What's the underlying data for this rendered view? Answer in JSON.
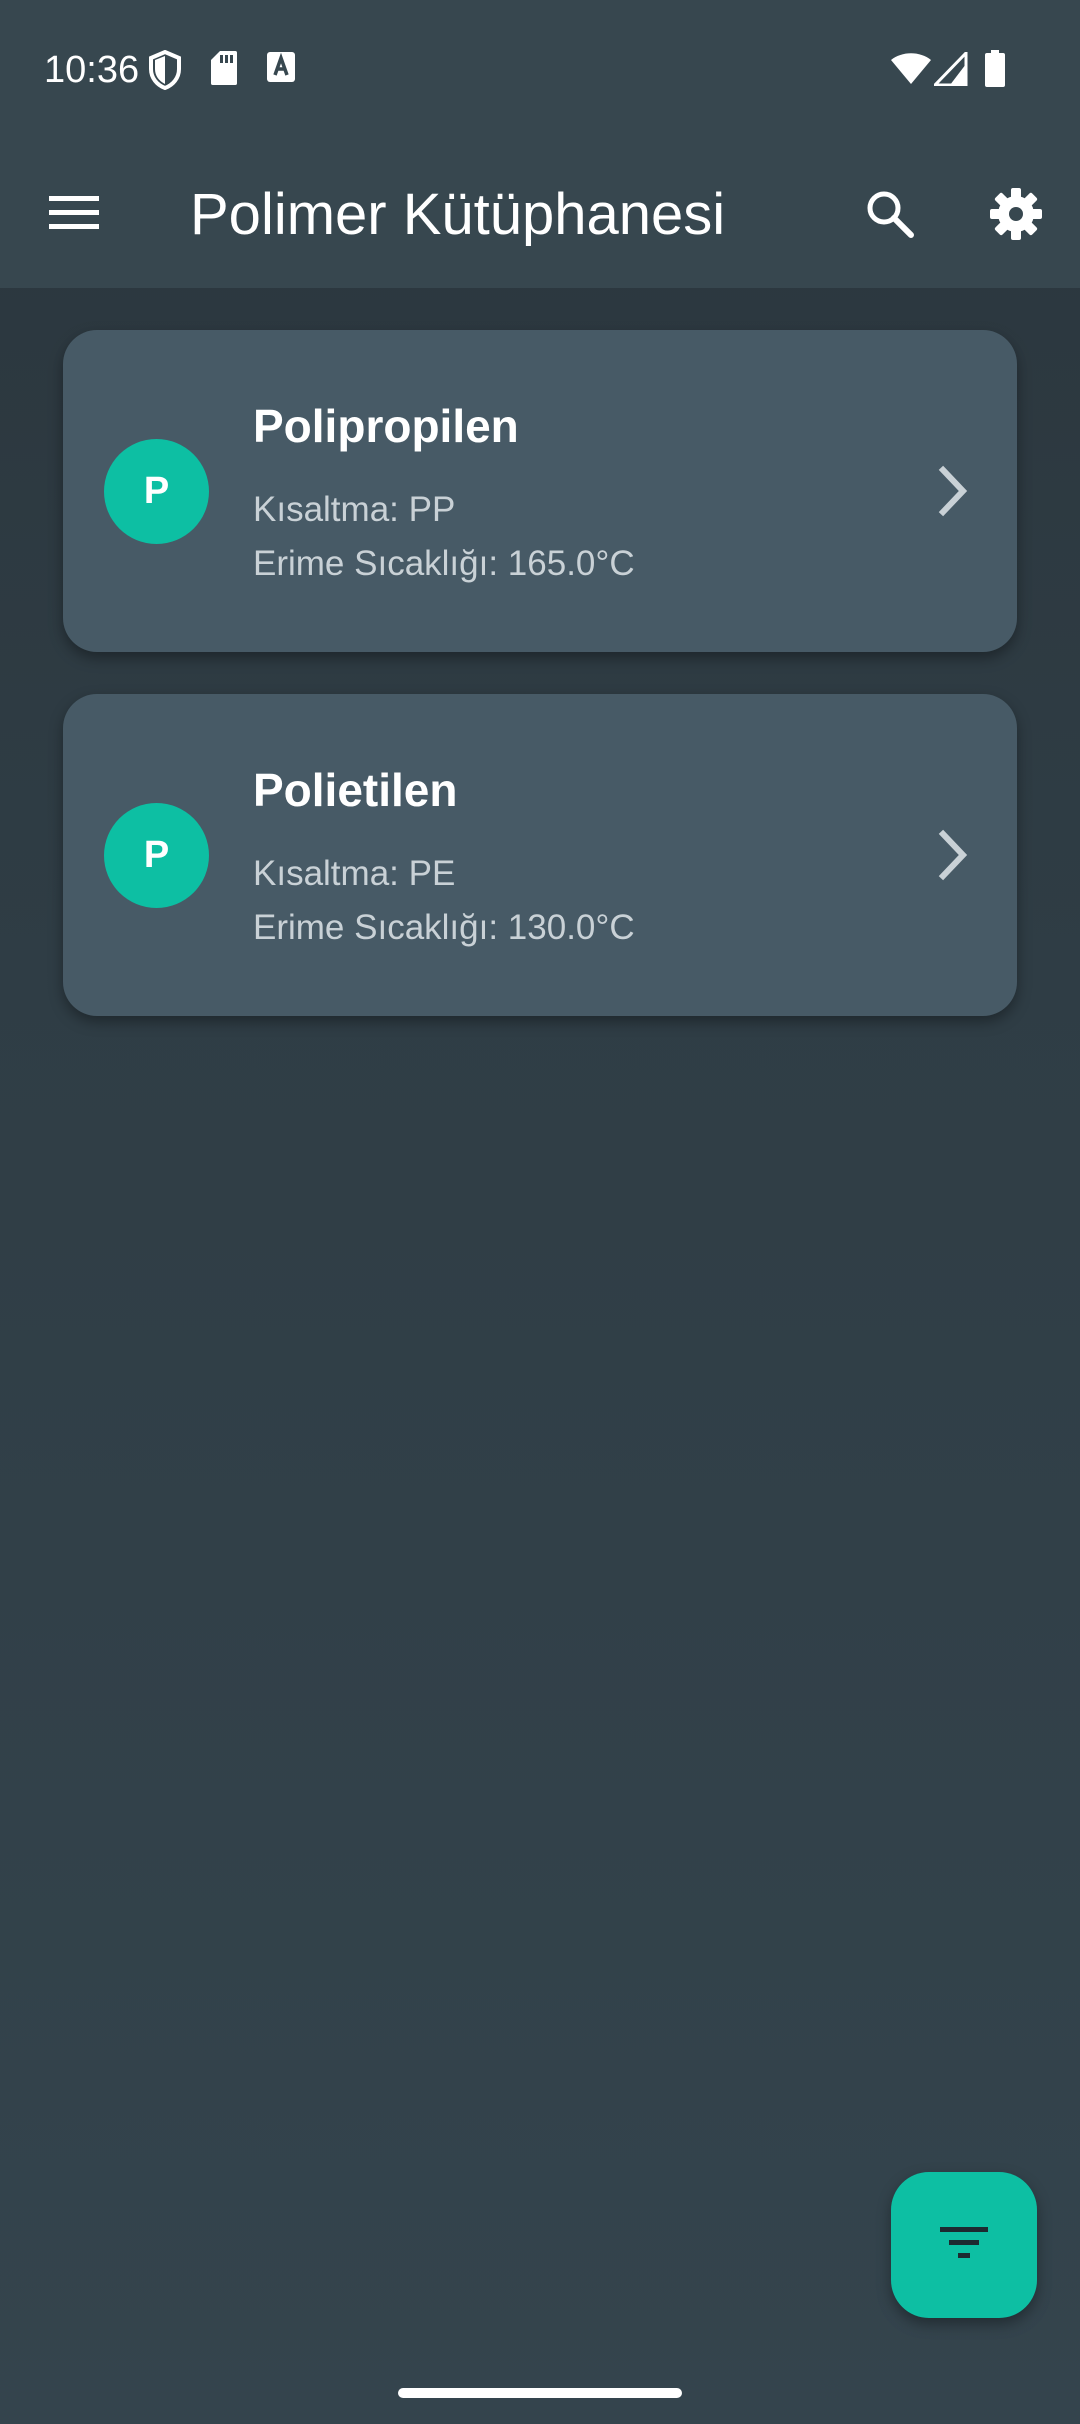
{
  "status_bar": {
    "time": "10:36",
    "left_icons": [
      "shield-icon",
      "sd-card-icon",
      "font-download-icon"
    ],
    "right_icons": [
      "wifi-icon",
      "cellular-signal-icon",
      "battery-icon"
    ]
  },
  "app_bar": {
    "title": "Polimer Kütüphanesi",
    "menu_icon": "menu-icon",
    "search_icon": "search-icon",
    "settings_icon": "gear-icon"
  },
  "polymers": [
    {
      "avatar_letter": "P",
      "name": "Polipropilen",
      "abbreviation_line": "Kısaltma: PP",
      "melting_line": "Erime Sıcaklığı: 165.0°C"
    },
    {
      "avatar_letter": "P",
      "name": "Polietilen",
      "abbreviation_line": "Kısaltma: PE",
      "melting_line": "Erime Sıcaklığı: 130.0°C"
    }
  ],
  "fab": {
    "icon": "filter-icon"
  },
  "colors": {
    "app_bar": "#37474f",
    "background": "#2f3d45",
    "card": "#475a66",
    "accent": "#0dbfa3"
  }
}
